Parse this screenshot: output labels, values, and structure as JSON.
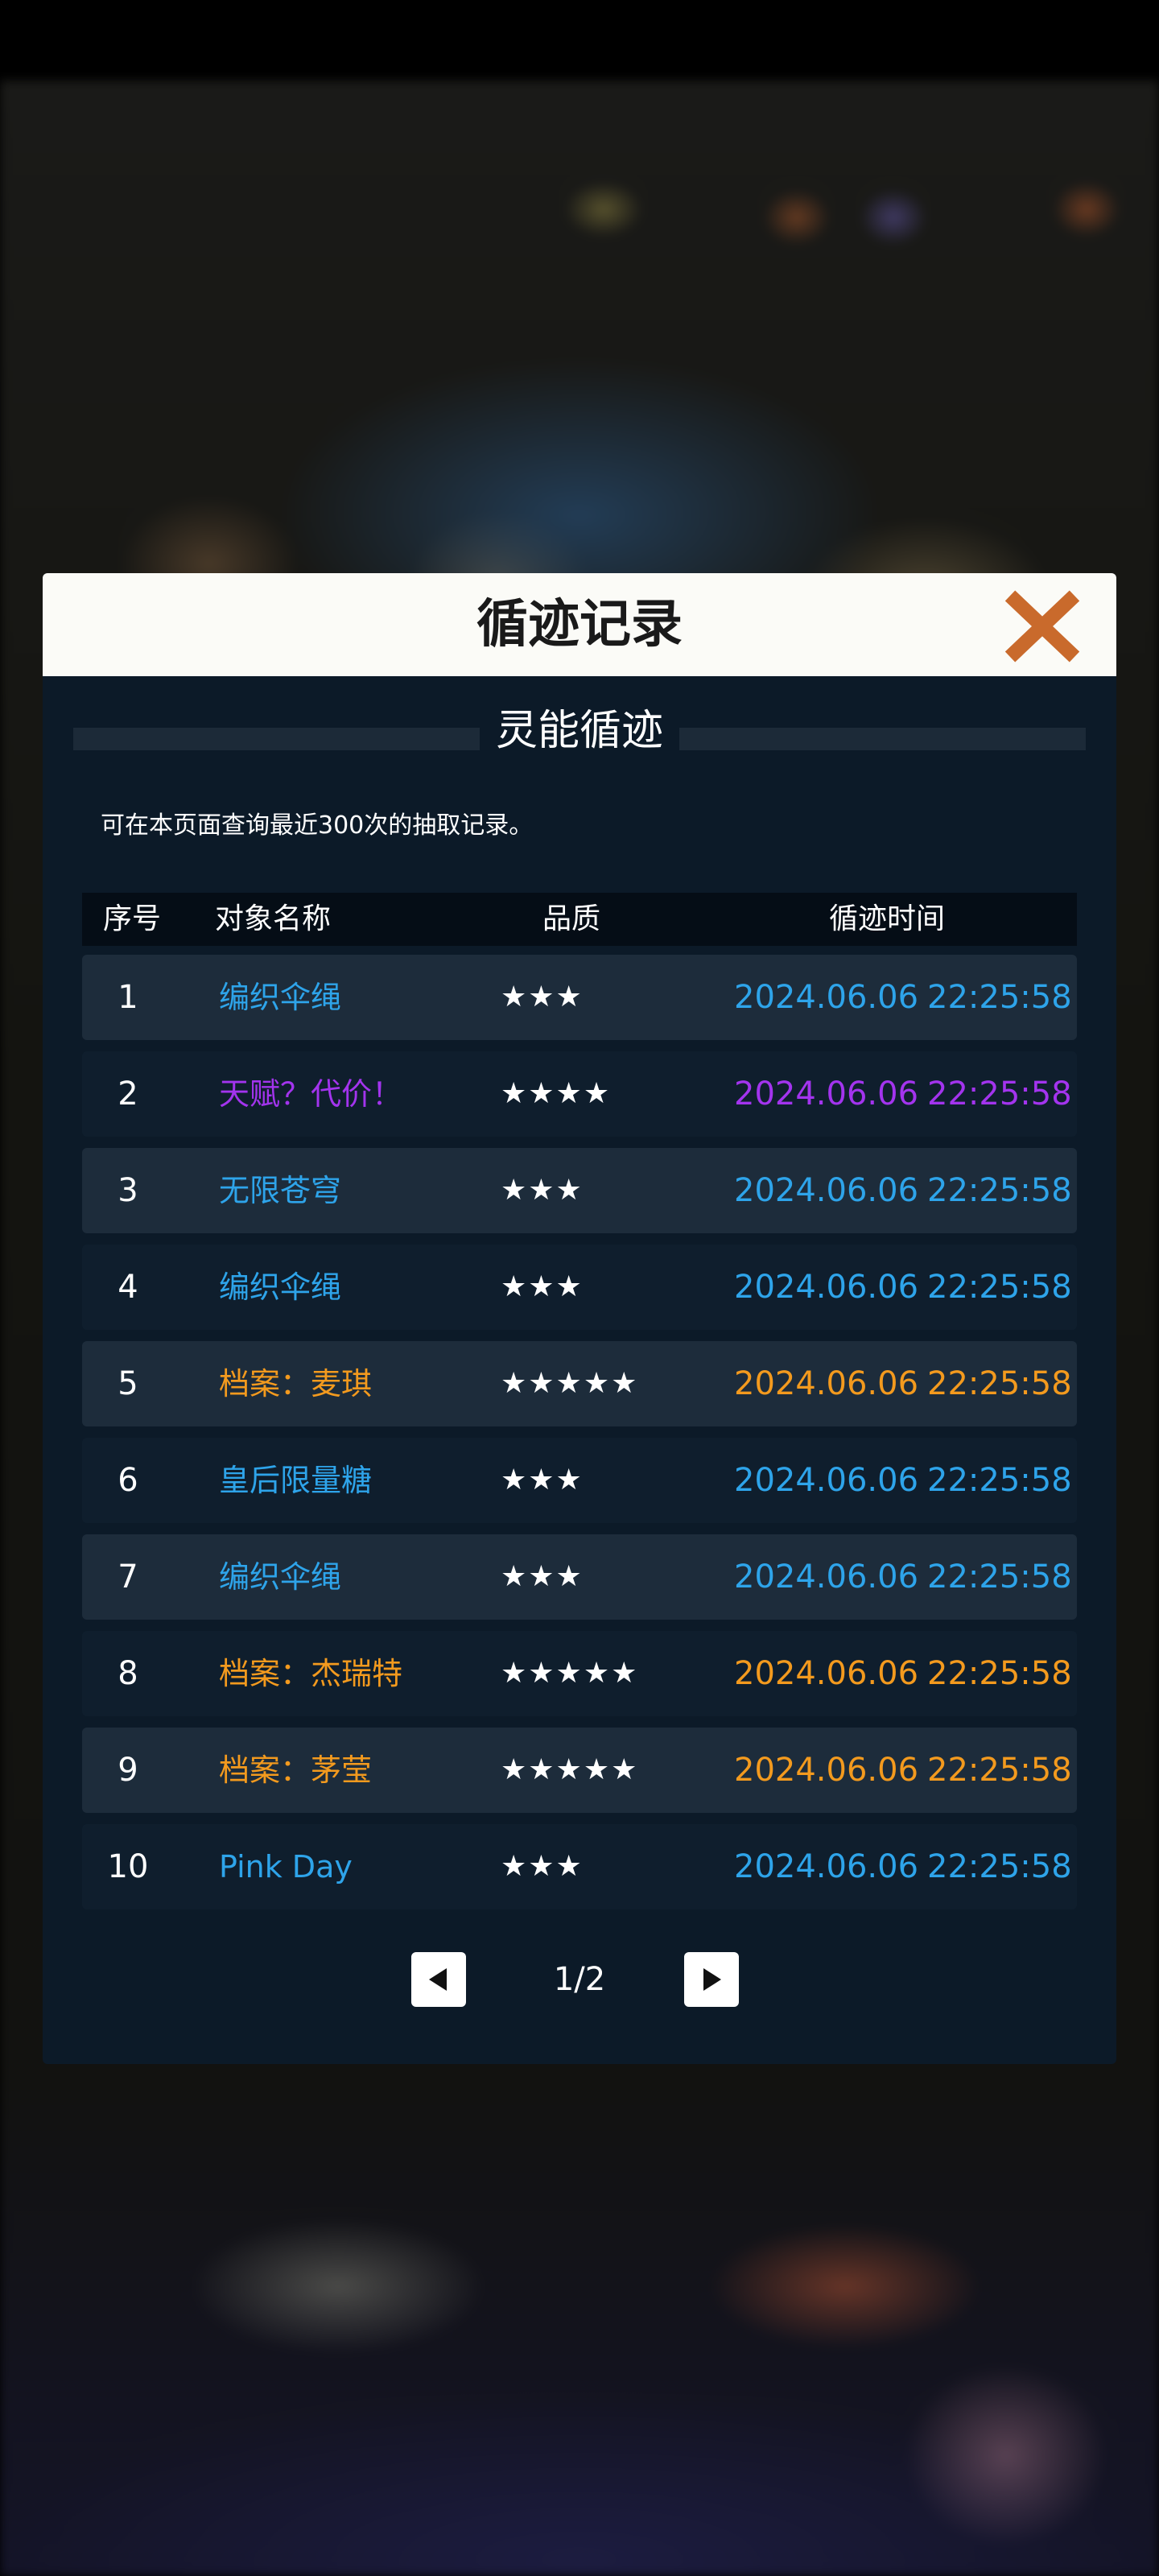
{
  "dialog": {
    "title": "循迹记录",
    "section_title": "灵能循迹",
    "info": "可在本页面查询最近300次的抽取记录。"
  },
  "table": {
    "headers": {
      "no": "序号",
      "name": "对象名称",
      "quality": "品质",
      "time": "循迹时间"
    },
    "rows": [
      {
        "no": "1",
        "name": "编织伞绳",
        "stars": "★★★",
        "date": "2024.06.06",
        "time": "22:25:58",
        "color": "#2ea4ea"
      },
      {
        "no": "2",
        "name": "天赋？代价！",
        "stars": "★★★★",
        "date": "2024.06.06",
        "time": "22:25:58",
        "color": "#a334ee"
      },
      {
        "no": "3",
        "name": "无限苍穹",
        "stars": "★★★",
        "date": "2024.06.06",
        "time": "22:25:58",
        "color": "#2ea4ea"
      },
      {
        "no": "4",
        "name": "编织伞绳",
        "stars": "★★★",
        "date": "2024.06.06",
        "time": "22:25:58",
        "color": "#2ea4ea"
      },
      {
        "no": "5",
        "name": "档案：麦琪",
        "stars": "★★★★★",
        "date": "2024.06.06",
        "time": "22:25:58",
        "color": "#f39a1e"
      },
      {
        "no": "6",
        "name": "皇后限量糖",
        "stars": "★★★",
        "date": "2024.06.06",
        "time": "22:25:58",
        "color": "#2ea4ea"
      },
      {
        "no": "7",
        "name": "编织伞绳",
        "stars": "★★★",
        "date": "2024.06.06",
        "time": "22:25:58",
        "color": "#2ea4ea"
      },
      {
        "no": "8",
        "name": "档案：杰瑞特",
        "stars": "★★★★★",
        "date": "2024.06.06",
        "time": "22:25:58",
        "color": "#f39a1e"
      },
      {
        "no": "9",
        "name": "档案：茅莹",
        "stars": "★★★★★",
        "date": "2024.06.06",
        "time": "22:25:58",
        "color": "#f39a1e"
      },
      {
        "no": "10",
        "name": "Pink Day",
        "stars": "★★★",
        "date": "2024.06.06",
        "time": "22:25:58",
        "color": "#2ea4ea"
      }
    ]
  },
  "pagination": {
    "page_label": "1/2",
    "prev_icon": "triangle-left-icon",
    "next_icon": "triangle-right-icon"
  },
  "colors": {
    "close_icon": "#c96a2c",
    "header_bg": "#fbfbf7",
    "panel_bg": "#0c1a28",
    "rarity_3": "#2ea4ea",
    "rarity_4": "#a334ee",
    "rarity_5": "#f39a1e"
  }
}
